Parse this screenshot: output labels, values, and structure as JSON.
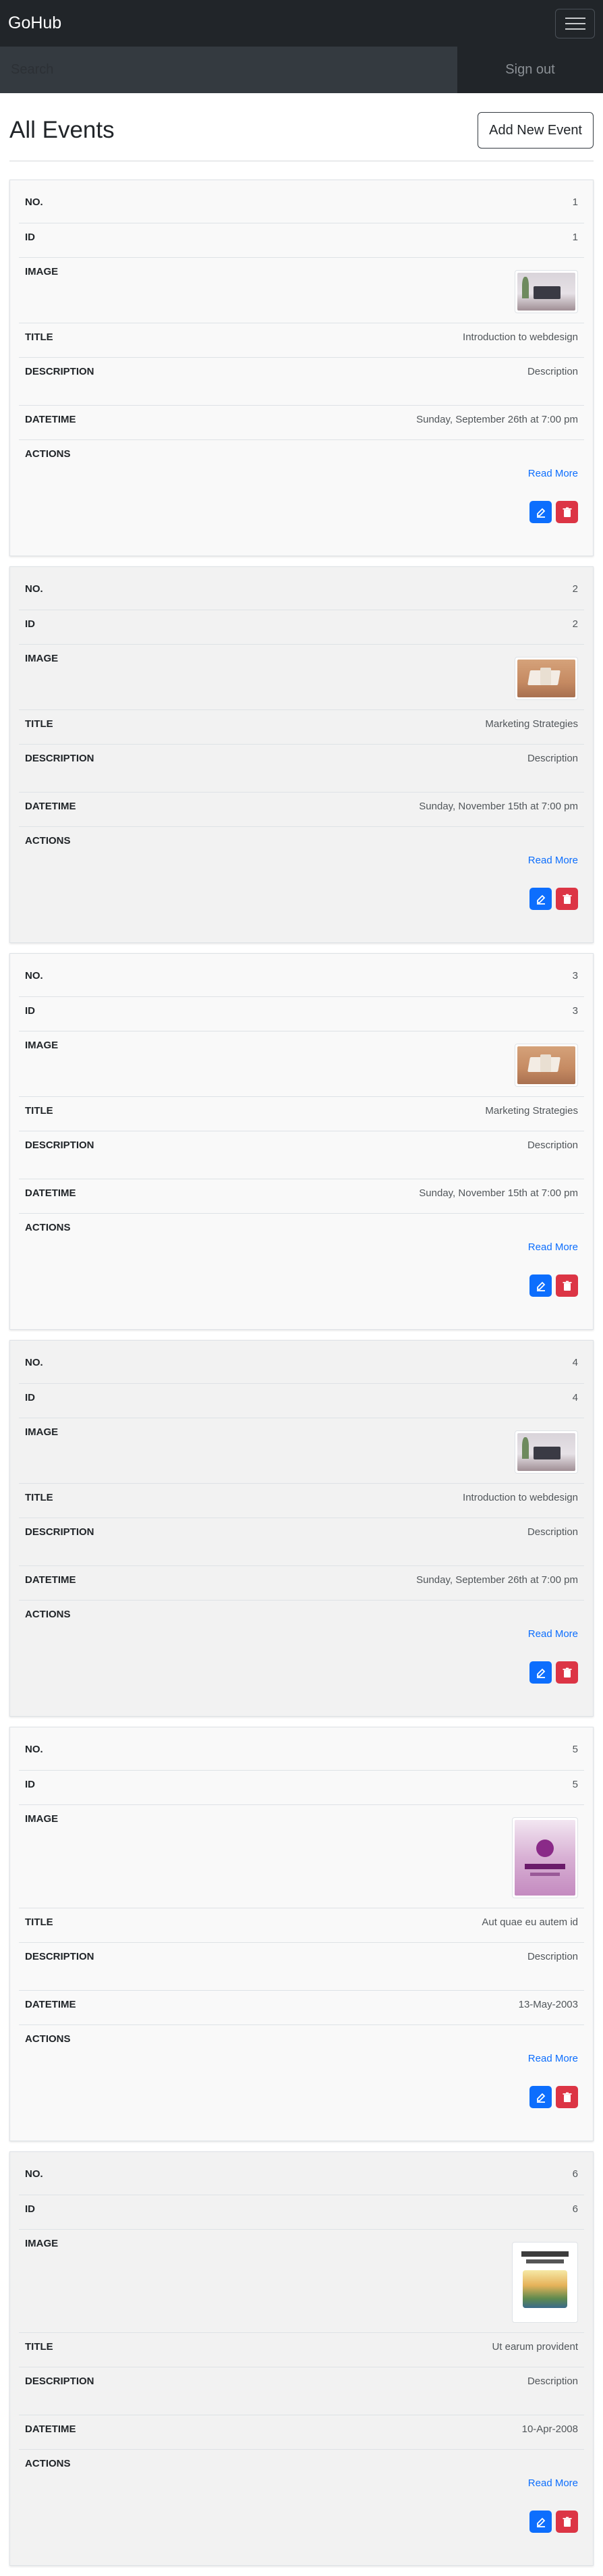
{
  "nav": {
    "brand": "GoHub"
  },
  "search": {
    "placeholder": "Search",
    "signout_label": "Sign out"
  },
  "page": {
    "title": "All Events",
    "add_button": "Add New Event"
  },
  "labels": {
    "no": "NO.",
    "id": "ID",
    "image": "IMAGE",
    "title": "TITLE",
    "description": "DESCRIPTION",
    "datetime": "DATETIME",
    "actions": "ACTIONS",
    "read_more": "Read More"
  },
  "events": [
    {
      "no": "1",
      "id": "1",
      "image": "office-desk-image",
      "title": "Introduction to webdesign",
      "description": "Description",
      "datetime": "Sunday, September 26th at 7:00 pm"
    },
    {
      "no": "2",
      "id": "2",
      "image": "open-book-image",
      "title": "Marketing Strategies",
      "description": "Description",
      "datetime": "Sunday, November 15th at 7:00 pm"
    },
    {
      "no": "3",
      "id": "3",
      "image": "open-book-image",
      "title": "Marketing Strategies",
      "description": "Description",
      "datetime": "Sunday, November 15th at 7:00 pm"
    },
    {
      "no": "4",
      "id": "4",
      "image": "office-desk-image",
      "title": "Introduction to webdesign",
      "description": "Description",
      "datetime": "Sunday, September 26th at 7:00 pm"
    },
    {
      "no": "5",
      "id": "5",
      "image": "purple-poster-image",
      "title": "Aut quae eu autem id",
      "description": "Description",
      "datetime": "13-May-2003"
    },
    {
      "no": "6",
      "id": "6",
      "image": "calendar-poster-image",
      "title": "Ut earum provident",
      "description": "Description",
      "datetime": "10-Apr-2008"
    }
  ],
  "colors": {
    "navbar": "#212529",
    "edit": "#0d6efd",
    "delete": "#dc3545",
    "link": "#0d6efd"
  },
  "icons": {
    "menu": "hamburger-icon",
    "edit": "edit-icon",
    "delete": "trash-icon"
  }
}
